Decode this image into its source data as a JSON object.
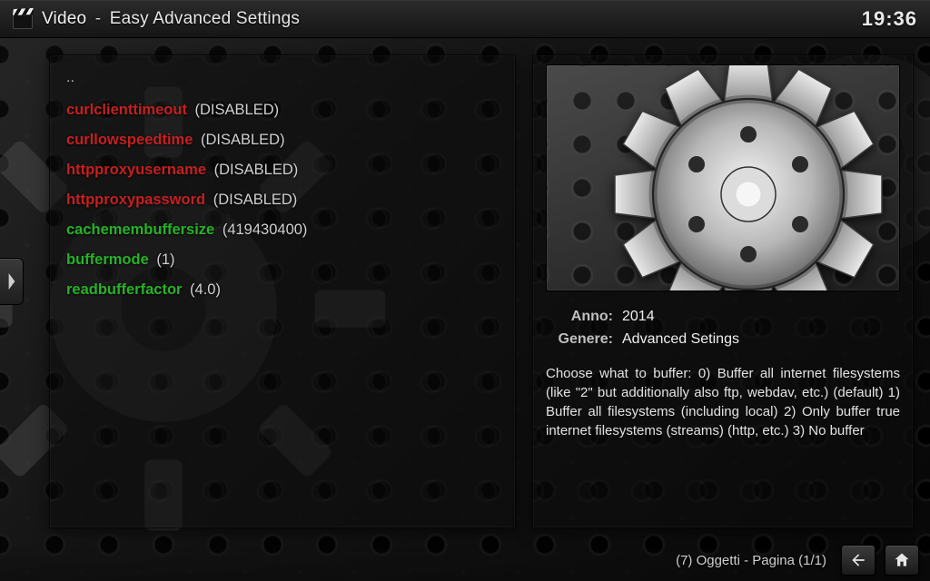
{
  "header": {
    "section": "Video",
    "title": "Easy Advanced Settings",
    "clock": "19:36"
  },
  "list": {
    "parent": "..",
    "items": [
      {
        "key": "curlclienttimeout",
        "value": "(DISABLED)",
        "enabled": false
      },
      {
        "key": "curllowspeedtime",
        "value": "(DISABLED)",
        "enabled": false
      },
      {
        "key": "httpproxyusername",
        "value": "(DISABLED)",
        "enabled": false
      },
      {
        "key": "httpproxypassword",
        "value": "(DISABLED)",
        "enabled": false
      },
      {
        "key": "cachemembuffersize",
        "value": "(419430400)",
        "enabled": true
      },
      {
        "key": "buffermode",
        "value": "(1)",
        "enabled": true
      },
      {
        "key": "readbufferfactor",
        "value": "(4.0)",
        "enabled": true
      }
    ]
  },
  "details": {
    "meta": {
      "year_label": "Anno:",
      "year_value": "2014",
      "genre_label": "Genere:",
      "genre_value": "Advanced Setings"
    },
    "description": "Choose what to buffer: 0) Buffer all internet filesystems (like \"2\" but additionally also ftp, webdav, etc.) (default) 1) Buffer all filesystems (including local) 2) Only buffer true internet filesystems (streams) (http, etc.) 3) No buffer"
  },
  "footer": {
    "status": "(7) Oggetti - Pagina (1/1)"
  }
}
